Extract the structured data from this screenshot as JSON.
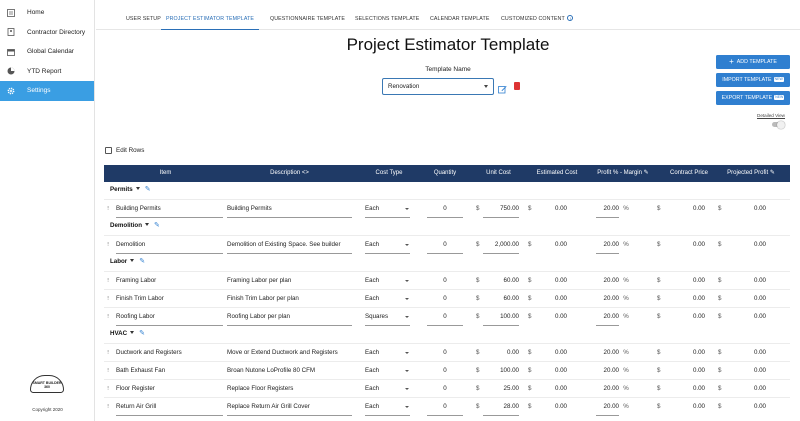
{
  "sidebar": {
    "items": [
      {
        "label": "Home",
        "icon": "home-icon"
      },
      {
        "label": "Contractor Directory",
        "icon": "directory-icon"
      },
      {
        "label": "Global Calendar",
        "icon": "calendar-icon"
      },
      {
        "label": "YTD Report",
        "icon": "pie-chart-icon"
      },
      {
        "label": "Settings",
        "icon": "gear-icon"
      }
    ],
    "logo_text": "SMART BUILDER 360",
    "copyright": "Copyright 2020"
  },
  "tabs": [
    {
      "label": "USER SETUP"
    },
    {
      "label": "PROJECT ESTIMATOR TEMPLATE"
    },
    {
      "label": "QUESTIONNAIRE TEMPLATE"
    },
    {
      "label": "SELECTIONS TEMPLATE"
    },
    {
      "label": "CALENDAR TEMPLATE"
    },
    {
      "label": "CUSTOMIZED CONTENT"
    }
  ],
  "page": {
    "title": "Project Estimator Template",
    "template_name_label": "Template Name",
    "template_name_value": "Renovation",
    "add_template": "ADD TEMPLATE",
    "import_template": "IMPORT TEMPLATE",
    "export_template": "EXPORT TEMPLATE",
    "new_badge": "NEW",
    "detailed_view": "Detailed View",
    "edit_rows": "Edit Rows"
  },
  "table": {
    "headers": [
      "Item",
      "Description",
      "Cost Type",
      "Quantity",
      "Unit Cost",
      "Estimated Cost",
      "Profit % - Margin",
      "Contract Price",
      "Projected Profit"
    ],
    "currency": "$",
    "percent": "%",
    "groups": [
      {
        "name": "Permits",
        "rows": [
          {
            "item": "Building Permits",
            "description": "Building Permits",
            "cost_type": "Each",
            "quantity": "0",
            "unit_cost": "750.00",
            "estimated": "0.00",
            "profit": "20.00",
            "contract": "0.00",
            "projected": "0.00"
          }
        ]
      },
      {
        "name": "Demolition",
        "rows": [
          {
            "item": "Demolition",
            "description": "Demolition of Existing Space. See builder",
            "cost_type": "Each",
            "quantity": "0",
            "unit_cost": "2,000.00",
            "estimated": "0.00",
            "profit": "20.00",
            "contract": "0.00",
            "projected": "0.00"
          }
        ]
      },
      {
        "name": "Labor",
        "rows": [
          {
            "item": "Framing Labor",
            "description": "Framing Labor per plan",
            "cost_type": "Each",
            "quantity": "0",
            "unit_cost": "60.00",
            "estimated": "0.00",
            "profit": "20.00",
            "contract": "0.00",
            "projected": "0.00"
          },
          {
            "item": "Finish Trim Labor",
            "description": "Finish Trim Labor per plan",
            "cost_type": "Each",
            "quantity": "0",
            "unit_cost": "60.00",
            "estimated": "0.00",
            "profit": "20.00",
            "contract": "0.00",
            "projected": "0.00"
          },
          {
            "item": "Roofing Labor",
            "description": "Roofing Labor per plan",
            "cost_type": "Squares",
            "quantity": "0",
            "unit_cost": "100.00",
            "estimated": "0.00",
            "profit": "20.00",
            "contract": "0.00",
            "projected": "0.00"
          }
        ]
      },
      {
        "name": "HVAC",
        "rows": [
          {
            "item": "Ductwork and Registers",
            "description": "Move or Extend Ductwork and Registers",
            "cost_type": "Each",
            "quantity": "0",
            "unit_cost": "0.00",
            "estimated": "0.00",
            "profit": "20.00",
            "contract": "0.00",
            "projected": "0.00"
          },
          {
            "item": "Bath Exhaust Fan",
            "description": "Broan Nutone LoProfile 80 CFM",
            "cost_type": "Each",
            "quantity": "0",
            "unit_cost": "100.00",
            "estimated": "0.00",
            "profit": "20.00",
            "contract": "0.00",
            "projected": "0.00"
          },
          {
            "item": "Floor Register",
            "description": "Replace Floor Registers",
            "cost_type": "Each",
            "quantity": "0",
            "unit_cost": "25.00",
            "estimated": "0.00",
            "profit": "20.00",
            "contract": "0.00",
            "projected": "0.00"
          },
          {
            "item": "Return Air Grill",
            "description": "Replace Return Air Grill Cover",
            "cost_type": "Each",
            "quantity": "0",
            "unit_cost": "28.00",
            "estimated": "0.00",
            "profit": "20.00",
            "contract": "0.00",
            "projected": "0.00"
          }
        ]
      }
    ]
  },
  "colors": {
    "accent": "#3a9ee3",
    "header": "#1f3a66",
    "button": "#2f7fd0",
    "delete": "#dd3333"
  }
}
